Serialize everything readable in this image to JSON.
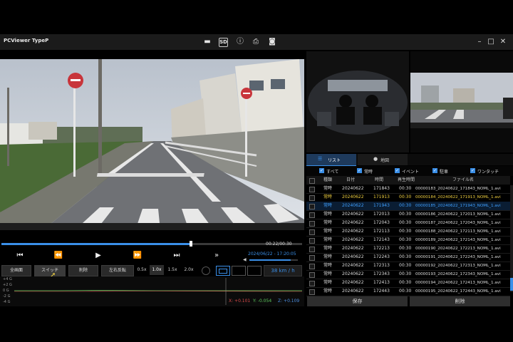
{
  "window": {
    "title": "PCViewer TypeP"
  },
  "toolbar": {
    "icons": [
      {
        "name": "folder-icon",
        "glyph": "▬"
      },
      {
        "name": "sd-card-icon",
        "glyph": "SD"
      },
      {
        "name": "info-icon",
        "glyph": "ⓘ"
      },
      {
        "name": "print-icon",
        "glyph": "⎙"
      },
      {
        "name": "camera-icon",
        "glyph": "◙"
      }
    ]
  },
  "window_controls": {
    "minimize": "–",
    "maximize": "□",
    "close": "✕"
  },
  "playback": {
    "time": "00:22/00:30",
    "progress": 0.63,
    "datetime": "2024/06/22 - 17:20:05",
    "speed_readout": "38 km / h",
    "volume": 0.85
  },
  "controls": {
    "prev": "⏮",
    "rewind": "⏪",
    "play": "▶",
    "forward": "⏩",
    "next": "⏭",
    "skip": "»"
  },
  "tools": {
    "fullscreen": "全画面",
    "switch": "スイッチ",
    "delete": "削除",
    "mirror": "左右反転",
    "speeds": [
      "0.5x",
      "1.0x",
      "1.5x",
      "2.0x"
    ]
  },
  "gsensor": {
    "labels": [
      "+4 G",
      "+2 G",
      "0 G",
      "-2 G",
      "-4 G"
    ],
    "x": "X: +0.101",
    "y": "Y: -0.054",
    "z": "Z: +0.109",
    "colors": {
      "x": "#d84a4a",
      "y": "#5cc85c",
      "z": "#4d8fe0"
    }
  },
  "panel": {
    "tab_list": "リスト",
    "tab_map": "地図",
    "filters": [
      "すべて",
      "常時",
      "イベント",
      "駐車",
      "ワンタッチ"
    ],
    "headers": [
      "種類",
      "日付",
      "時間",
      "再生時間",
      "ファイル名"
    ],
    "save": "保存",
    "delete": "削除"
  },
  "files": [
    {
      "type": "常時",
      "date": "20240622",
      "time": "171843",
      "dur": "00:30",
      "name": "00000183_20240622_171843_NOML_1.avi",
      "state": "normal"
    },
    {
      "type": "常時",
      "date": "20240622",
      "time": "171913",
      "dur": "00:30",
      "name": "00000184_20240622_171913_NOML_1.avi",
      "state": "selected"
    },
    {
      "type": "常時",
      "date": "20240622",
      "time": "171943",
      "dur": "00:30",
      "name": "00000185_20240622_171943_NOML_1.avi",
      "state": "playing"
    },
    {
      "type": "常時",
      "date": "20240622",
      "time": "172013",
      "dur": "00:30",
      "name": "00000186_20240622_172013_NOML_1.avi",
      "state": "normal"
    },
    {
      "type": "常時",
      "date": "20240622",
      "time": "172043",
      "dur": "00:30",
      "name": "00000187_20240622_172043_NOML_1.avi",
      "state": "normal"
    },
    {
      "type": "常時",
      "date": "20240622",
      "time": "172113",
      "dur": "00:30",
      "name": "00000188_20240622_172113_NOML_1.avi",
      "state": "normal"
    },
    {
      "type": "常時",
      "date": "20240622",
      "time": "172143",
      "dur": "00:30",
      "name": "00000189_20240622_172143_NOML_1.avi",
      "state": "normal"
    },
    {
      "type": "常時",
      "date": "20240622",
      "time": "172213",
      "dur": "00:30",
      "name": "00000190_20240622_172213_NOML_1.avi",
      "state": "normal"
    },
    {
      "type": "常時",
      "date": "20240622",
      "time": "172243",
      "dur": "00:30",
      "name": "00000191_20240622_172243_NOML_1.avi",
      "state": "normal"
    },
    {
      "type": "常時",
      "date": "20240622",
      "time": "172313",
      "dur": "00:30",
      "name": "00000192_20240622_172313_NOML_1.avi",
      "state": "normal"
    },
    {
      "type": "常時",
      "date": "20240622",
      "time": "172343",
      "dur": "00:30",
      "name": "00000193_20240622_172343_NOML_1.avi",
      "state": "normal"
    },
    {
      "type": "常時",
      "date": "20240622",
      "time": "172413",
      "dur": "00:30",
      "name": "00000194_20240622_172413_NOML_1.avi",
      "state": "normal"
    },
    {
      "type": "常時",
      "date": "20240622",
      "time": "172443",
      "dur": "00:30",
      "name": "00000195_20240622_172443_NOML_1.avi",
      "state": "normal"
    }
  ],
  "colors": {
    "accent": "#3a8fe8",
    "selected_text": "#f0d040",
    "playing_text": "#3fa0ff"
  }
}
